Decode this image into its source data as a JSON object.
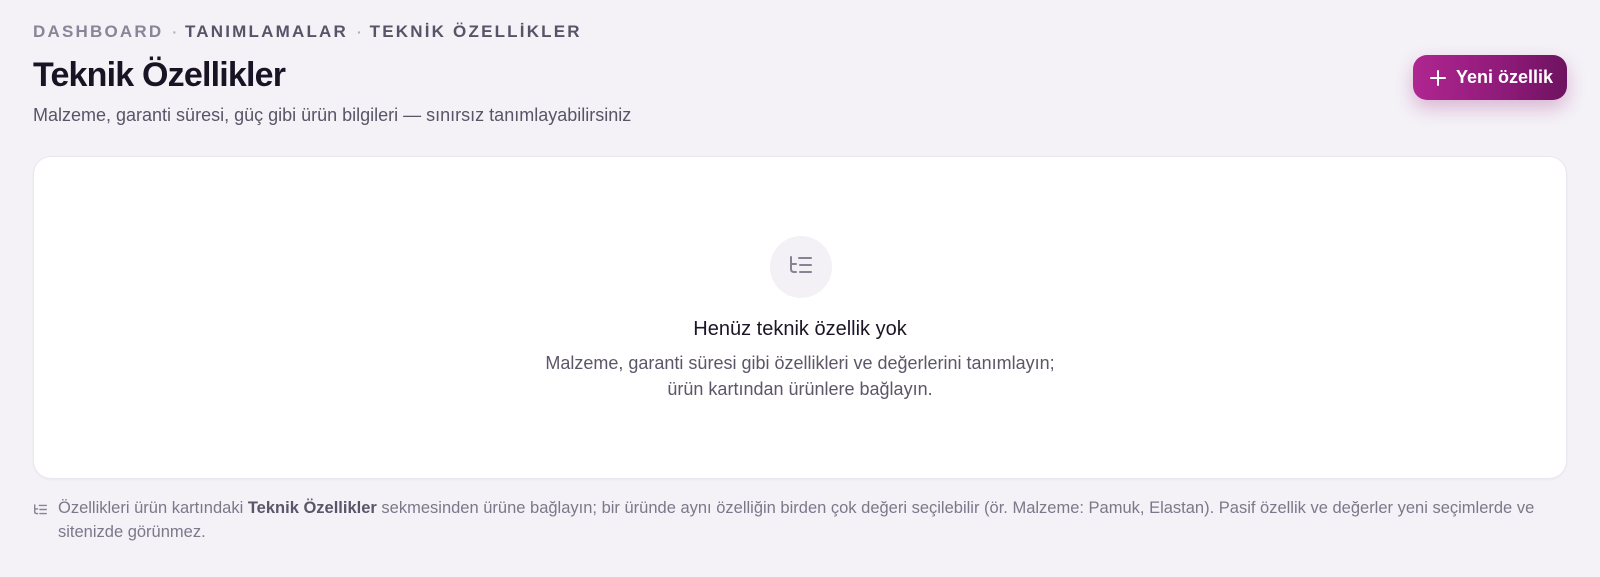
{
  "breadcrumb": {
    "items": [
      "DASHBOARD",
      "TANIMLAMALAR",
      "TEKNİK ÖZELLİKLER"
    ],
    "separator": "·"
  },
  "header": {
    "title": "Teknik Özellikler",
    "subtitle": "Malzeme, garanti süresi, güç gibi ürün bilgileri — sınırsız tanımlayabilirsiniz",
    "new_button_label": "Yeni özellik",
    "new_button_icon": "plus-icon"
  },
  "empty_state": {
    "icon": "list-tree-icon",
    "title": "Henüz teknik özellik yok",
    "description_line1": "Malzeme, garanti süresi gibi özellikleri ve değerlerini tanımlayın;",
    "description_line2": "ürün kartından ürünlere bağlayın."
  },
  "footnote": {
    "icon": "list-tree-icon",
    "text_before": "Özellikleri ürün kartındaki ",
    "text_bold": "Teknik Özellikler",
    "text_after": " sekmesinden ürüne bağlayın; bir üründe aynı özelliğin birden çok değeri seçilebilir (ör. Malzeme: Pamuk, Elastan). Pasif özellik ve değerler yeni seçimlerde ve sitenizde görünmez."
  },
  "colors": {
    "background": "#f4f1f7",
    "accent": "#a3228a",
    "accent_dark": "#6e1360",
    "text_primary": "#1a1324",
    "text_muted": "#7e778a"
  }
}
